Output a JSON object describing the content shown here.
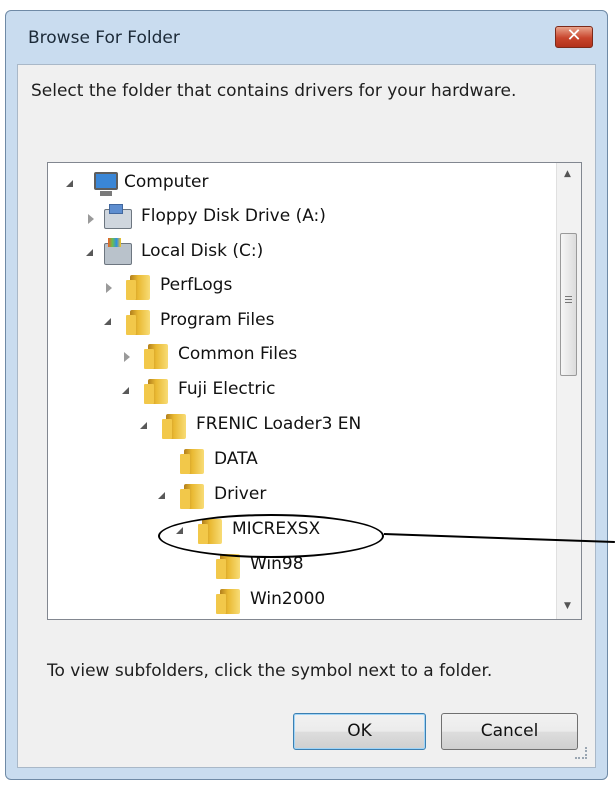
{
  "window": {
    "title": "Browse For Folder",
    "close_symbol": "✕"
  },
  "instruction": "Select the folder that contains drivers for your hardware.",
  "tree": {
    "items": [
      {
        "label": "Computer",
        "icon": "computer-icon",
        "state": "expanded"
      },
      {
        "label": "Floppy Disk Drive (A:)",
        "icon": "floppy-drive-icon",
        "state": "collapsed"
      },
      {
        "label": "Local Disk (C:)",
        "icon": "local-disk-icon",
        "state": "expanded"
      },
      {
        "label": "PerfLogs",
        "icon": "folder-icon",
        "state": "collapsed"
      },
      {
        "label": "Program Files",
        "icon": "folder-icon",
        "state": "expanded"
      },
      {
        "label": "Common Files",
        "icon": "folder-icon",
        "state": "collapsed"
      },
      {
        "label": "Fuji Electric",
        "icon": "folder-icon",
        "state": "expanded"
      },
      {
        "label": "FRENIC Loader3 EN",
        "icon": "folder-icon",
        "state": "expanded"
      },
      {
        "label": "DATA",
        "icon": "folder-icon",
        "state": "leaf"
      },
      {
        "label": "Driver",
        "icon": "folder-icon",
        "state": "expanded"
      },
      {
        "label": "MICREXSX",
        "icon": "folder-icon",
        "state": "expanded",
        "highlighted": true
      },
      {
        "label": "Win98",
        "icon": "folder-icon",
        "state": "leaf"
      },
      {
        "label": "Win2000",
        "icon": "folder-icon",
        "state": "leaf"
      }
    ]
  },
  "hint": "To view subfolders, click the symbol next to a folder.",
  "buttons": {
    "ok": "OK",
    "cancel": "Cancel"
  },
  "colors": {
    "frame": "#c9dcef",
    "close_button": "#c8452d",
    "folder": "#e9b932",
    "client": "#f0f0f0"
  }
}
